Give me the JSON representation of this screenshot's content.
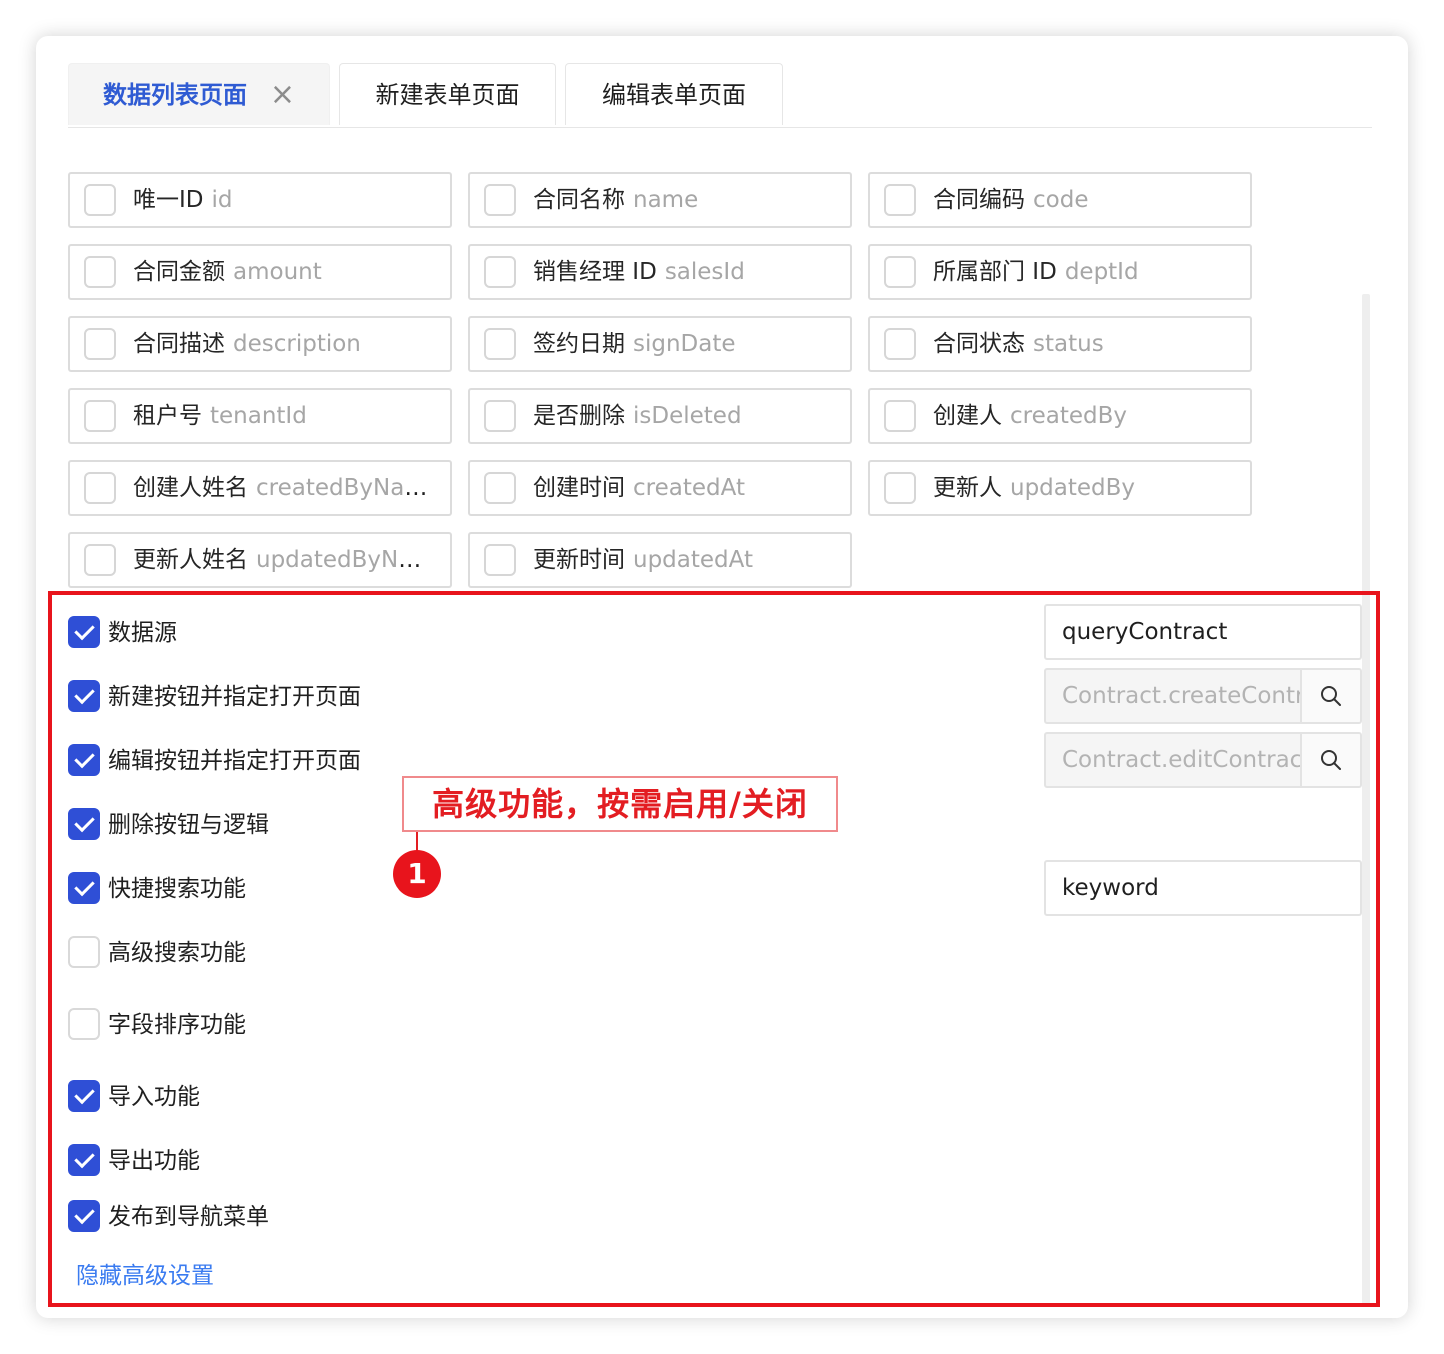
{
  "tabs": [
    {
      "label": "数据列表页面",
      "active": true
    },
    {
      "label": "新建表单页面",
      "active": false
    },
    {
      "label": "编辑表单页面",
      "active": false
    }
  ],
  "fields": [
    {
      "cn": "唯一ID",
      "en": "id"
    },
    {
      "cn": "合同名称",
      "en": "name"
    },
    {
      "cn": "合同编码",
      "en": "code"
    },
    {
      "cn": "合同金额",
      "en": "amount"
    },
    {
      "cn": "销售经理 ID",
      "en": "salesId"
    },
    {
      "cn": "所属部门 ID",
      "en": "deptId"
    },
    {
      "cn": "合同描述",
      "en": "description"
    },
    {
      "cn": "签约日期",
      "en": "signDate"
    },
    {
      "cn": "合同状态",
      "en": "status"
    },
    {
      "cn": "租户号",
      "en": "tenantId"
    },
    {
      "cn": "是否删除",
      "en": "isDeleted"
    },
    {
      "cn": "创建人",
      "en": "createdBy"
    },
    {
      "cn": "创建人姓名",
      "en": "createdByName"
    },
    {
      "cn": "创建时间",
      "en": "createdAt"
    },
    {
      "cn": "更新人",
      "en": "updatedBy"
    },
    {
      "cn": "更新人姓名",
      "en": "updatedByNa..."
    },
    {
      "cn": "更新时间",
      "en": "updatedAt"
    }
  ],
  "options": [
    {
      "label": "数据源",
      "checked": true
    },
    {
      "label": "新建按钮并指定打开页面",
      "checked": true
    },
    {
      "label": "编辑按钮并指定打开页面",
      "checked": true
    },
    {
      "label": "删除按钮与逻辑",
      "checked": true
    },
    {
      "label": "快捷搜索功能",
      "checked": true
    },
    {
      "label": "高级搜索功能",
      "checked": false
    },
    {
      "label": "字段排序功能",
      "checked": false
    },
    {
      "label": "导入功能",
      "checked": true
    },
    {
      "label": "导出功能",
      "checked": true
    },
    {
      "label": "发布到导航菜单",
      "checked": true
    }
  ],
  "inputs": {
    "data_source": "queryContract",
    "create_page": "Contract.createContra",
    "edit_page": "Contract.editContract",
    "search_keyword": "keyword"
  },
  "hide_advanced_label": "隐藏高级设置",
  "annotation": {
    "text": "高级功能，按需启用/关闭",
    "number": "1",
    "color": "#e8141c"
  },
  "colors": {
    "accent": "#2f4fd6",
    "link": "#3a7bf0",
    "active_tab": "#2f5bd3"
  }
}
